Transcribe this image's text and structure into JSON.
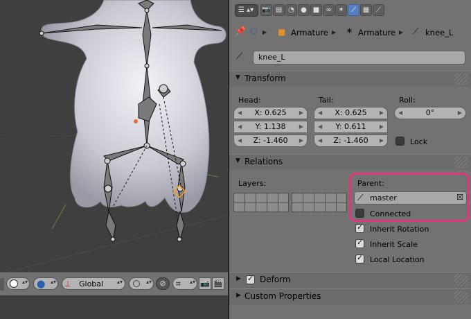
{
  "viewport_header": {
    "transform_orientation": "Global"
  },
  "properties": {
    "breadcrumb": {
      "item1": "Armature",
      "item2": "Armature",
      "item3": "knee_L"
    },
    "bone_name": "knee_L",
    "transform": {
      "title": "Transform",
      "head_label": "Head:",
      "tail_label": "Tail:",
      "roll_label": "Roll:",
      "head": {
        "x": "X: 0.625",
        "y": "Y: 1.138",
        "z": "Z: -1.460"
      },
      "tail": {
        "x": "X: 0.625",
        "y": "Y: 0.611",
        "z": "Z: -1.460"
      },
      "roll": "0°",
      "lock_label": "Lock",
      "lock_checked": false
    },
    "relations": {
      "title": "Relations",
      "layers_label": "Layers:",
      "parent_label": "Parent:",
      "parent_value": "master",
      "connected_label": "Connected",
      "connected_checked": false,
      "inherit_rotation_label": "Inherit Rotation",
      "inherit_scale_label": "Inherit Scale",
      "local_location_label": "Local Location"
    },
    "deform": {
      "title": "Deform",
      "checked": true
    },
    "custom_properties": {
      "title": "Custom Properties"
    }
  },
  "colors": {
    "highlight": "#e0357f",
    "active_tab": "#5680c2",
    "mesh": "#d9d9e2"
  }
}
